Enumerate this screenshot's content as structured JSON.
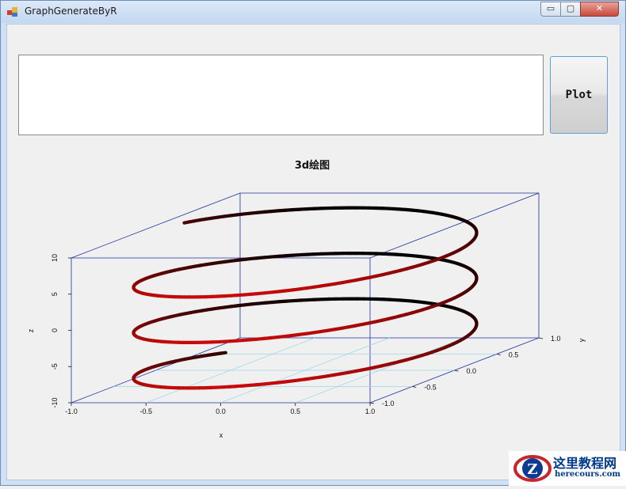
{
  "window": {
    "title": "GraphGenerateByR"
  },
  "titlebar_buttons": {
    "minimize": "▭",
    "maximize": "▢",
    "close": "✕"
  },
  "input": {
    "value": ""
  },
  "plot_button": {
    "label": "Plot"
  },
  "watermark": {
    "main": "这里教程网",
    "sub": "herecours.com"
  },
  "chart_data": {
    "type": "line3d",
    "title": "3d绘图",
    "xlabel": "x",
    "ylabel": "y",
    "zlabel": "z",
    "xlim": [
      -1,
      1
    ],
    "ylim": [
      -1,
      1
    ],
    "zlim": [
      -10,
      10
    ],
    "x_ticks": [
      "-1.0",
      "-0.5",
      "0.0",
      "0.5",
      "1.0"
    ],
    "y_ticks": [
      "-1.0",
      "-0.5",
      "0.0",
      "0.5",
      "1.0"
    ],
    "z_ticks": [
      "-10",
      "-5",
      "0",
      "5",
      "10"
    ],
    "series": [
      {
        "x": "cos(t)",
        "y": "sin(t)",
        "z": "t/π",
        "t_range": [
          -10,
          9.15
        ],
        "colors": [
          "#000000",
          "#c00000"
        ]
      }
    ]
  }
}
